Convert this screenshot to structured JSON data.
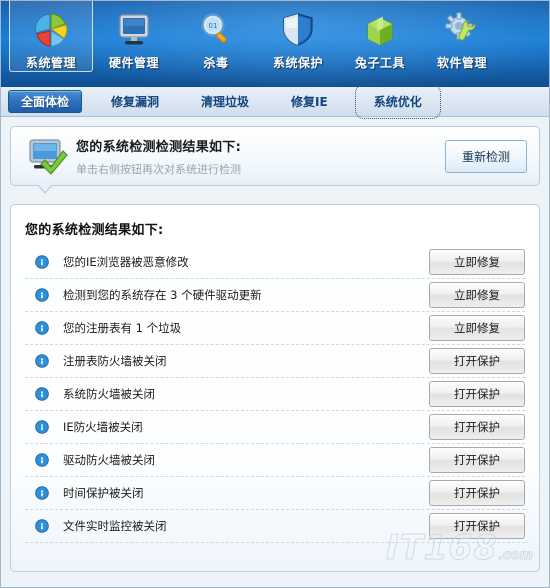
{
  "header": {
    "nav": [
      {
        "label": "系统管理",
        "icon": "pie-chart-icon",
        "active": true
      },
      {
        "label": "硬件管理",
        "icon": "monitor-icon",
        "active": false
      },
      {
        "label": "杀毒",
        "icon": "magnifier-icon",
        "active": false
      },
      {
        "label": "系统保护",
        "icon": "shield-icon",
        "active": false
      },
      {
        "label": "兔子工具",
        "icon": "green-box-icon",
        "active": false
      },
      {
        "label": "软件管理",
        "icon": "gear-wrench-icon",
        "active": false
      }
    ]
  },
  "tabs": [
    {
      "label": "全面体检",
      "active": true,
      "focused": false
    },
    {
      "label": "修复漏洞",
      "active": false,
      "focused": false
    },
    {
      "label": "清理垃圾",
      "active": false,
      "focused": false
    },
    {
      "label": "修复IE",
      "active": false,
      "focused": false
    },
    {
      "label": "系统优化",
      "active": false,
      "focused": true
    }
  ],
  "info_panel": {
    "icon": "monitor-check-icon",
    "title": "您的系统检测检测结果如下:",
    "subtitle": "单击右侧按钮再次对系统进行检测",
    "button_label": "重新检测"
  },
  "results": {
    "title": "您的系统检测结果如下:",
    "items": [
      {
        "icon": "warning-icon",
        "label": "您的IE浏览器被恶意修改",
        "action": "立即修复"
      },
      {
        "icon": "warning-icon",
        "label": "检测到您的系统存在 3 个硬件驱动更新",
        "action": "立即修复"
      },
      {
        "icon": "warning-icon",
        "label": "您的注册表有 1 个垃圾",
        "action": "立即修复"
      },
      {
        "icon": "warning-icon",
        "label": "注册表防火墙被关闭",
        "action": "打开保护"
      },
      {
        "icon": "warning-icon",
        "label": "系统防火墙被关闭",
        "action": "打开保护"
      },
      {
        "icon": "warning-icon",
        "label": "IE防火墙被关闭",
        "action": "打开保护"
      },
      {
        "icon": "warning-icon",
        "label": "驱动防火墙被关闭",
        "action": "打开保护"
      },
      {
        "icon": "warning-icon",
        "label": "时间保护被关闭",
        "action": "打开保护"
      },
      {
        "icon": "warning-icon",
        "label": "文件实时监控被关闭",
        "action": "打开保护"
      }
    ]
  },
  "watermark": {
    "text": "IT168",
    "domain": ".com"
  },
  "colors": {
    "header_blue": "#1a7ed6",
    "active_tab_blue": "#2d71bd",
    "warning_icon_blue": "#2f8fd8",
    "panel_border": "#b6cde0"
  }
}
